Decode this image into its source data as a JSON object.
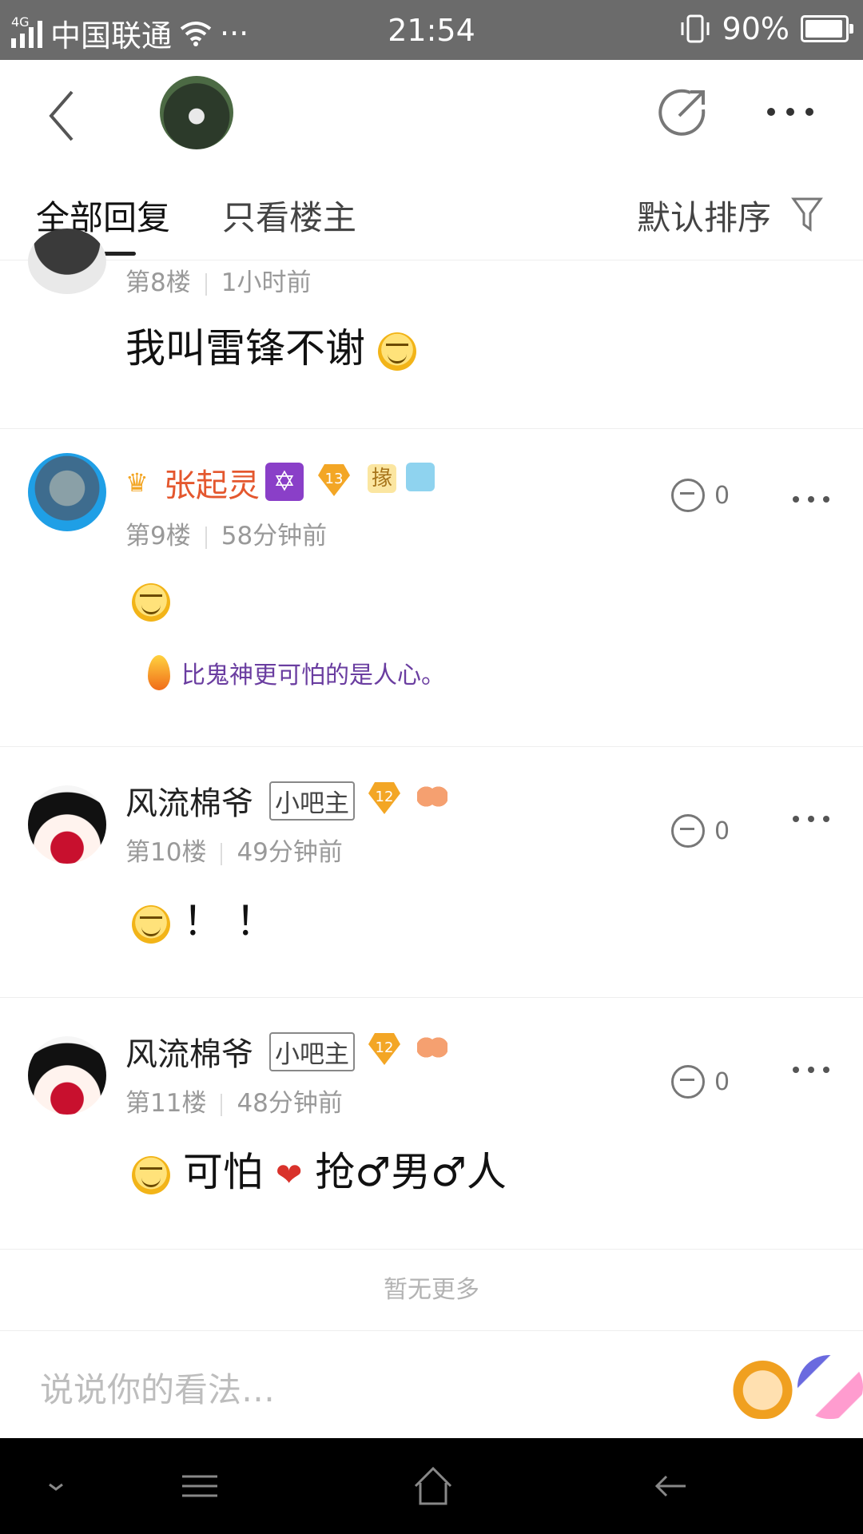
{
  "status_bar": {
    "network": "4G",
    "carrier": "中国联通",
    "dots": "···",
    "time": "21:54",
    "battery": "90%"
  },
  "tabs": {
    "all": "全部回复",
    "op_only": "只看楼主",
    "sort": "默认排序"
  },
  "posts": [
    {
      "floor": "第8楼",
      "time": "1小时前",
      "content": "我叫雷锋不谢"
    },
    {
      "username": "张起灵",
      "level": "13",
      "badge_text": "掾",
      "floor": "第9楼",
      "time": "58分钟前",
      "likes": "0",
      "tail": "比鬼神更可怕的是人心。"
    },
    {
      "username": "风流棉爷",
      "badge": "小吧主",
      "level": "12",
      "floor": "第10楼",
      "time": "49分钟前",
      "likes": "0",
      "content": "！ ！"
    },
    {
      "username": "风流棉爷",
      "badge": "小吧主",
      "level": "12",
      "floor": "第11楼",
      "time": "48分钟前",
      "likes": "0",
      "content_a": "可怕",
      "content_b": "抢♂男♂人"
    }
  ],
  "no_more": "暂无更多",
  "input_placeholder": "说说你的看法…",
  "colors": {
    "status_bar": "#6b6b6b",
    "vip_name": "#e4572e",
    "tail_text": "#6a3da0",
    "level_badge": "#f3a625"
  }
}
